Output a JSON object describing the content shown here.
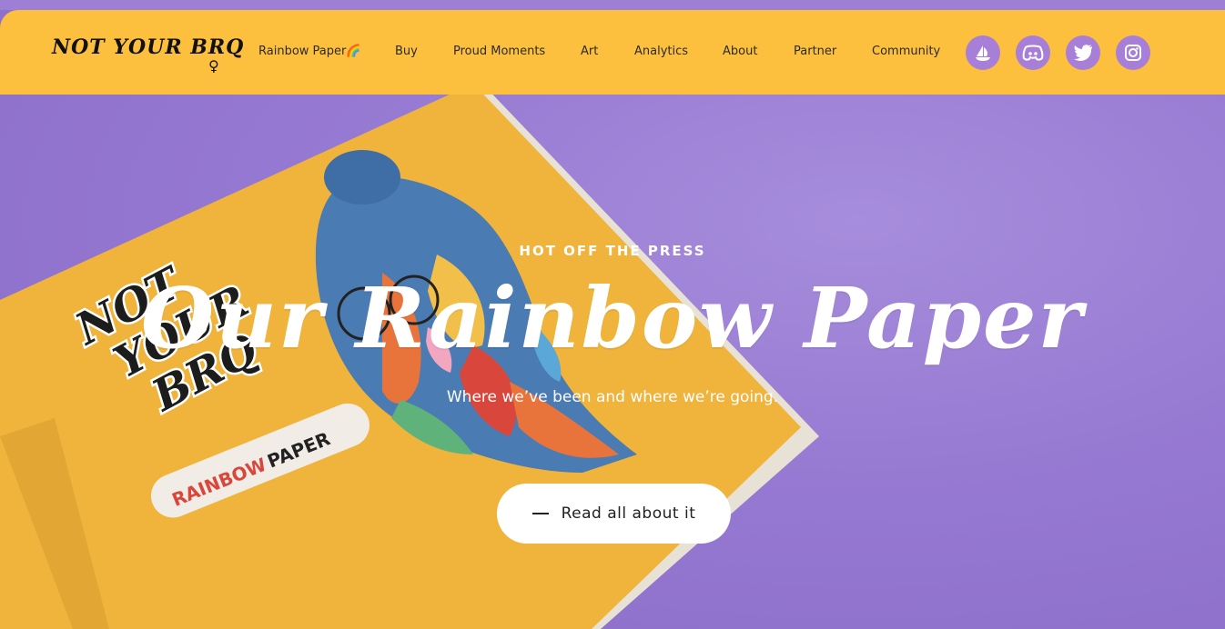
{
  "brand": {
    "logo_text": "NOT YOUR BRQ",
    "logo_symbol": "♀"
  },
  "nav": {
    "items": [
      {
        "label": "Rainbow Paper🌈"
      },
      {
        "label": "Buy"
      },
      {
        "label": "Proud Moments"
      },
      {
        "label": "Art"
      },
      {
        "label": "Analytics"
      },
      {
        "label": "About"
      },
      {
        "label": "Partner"
      },
      {
        "label": "Community"
      }
    ]
  },
  "social": [
    {
      "icon": "opensea-icon"
    },
    {
      "icon": "discord-icon"
    },
    {
      "icon": "twitter-icon"
    },
    {
      "icon": "instagram-icon"
    }
  ],
  "hero": {
    "kicker": "HOT OFF THE PRESS",
    "title": "Our Rainbow Paper",
    "subtitle": "Where we’ve been and where we’re going.",
    "cta_label": "Read all about it"
  },
  "book": {
    "cover_text_lines": [
      "NOT",
      "YOUR",
      "BRQ"
    ],
    "sticker_text_1": "RAINBOW",
    "sticker_text_2": "PAPER"
  },
  "colors": {
    "header_bg": "#fdbf3e",
    "hero_bg": "#9d7fd6",
    "social_bg": "#a77ed8",
    "book_cover": "#f0b43c"
  }
}
